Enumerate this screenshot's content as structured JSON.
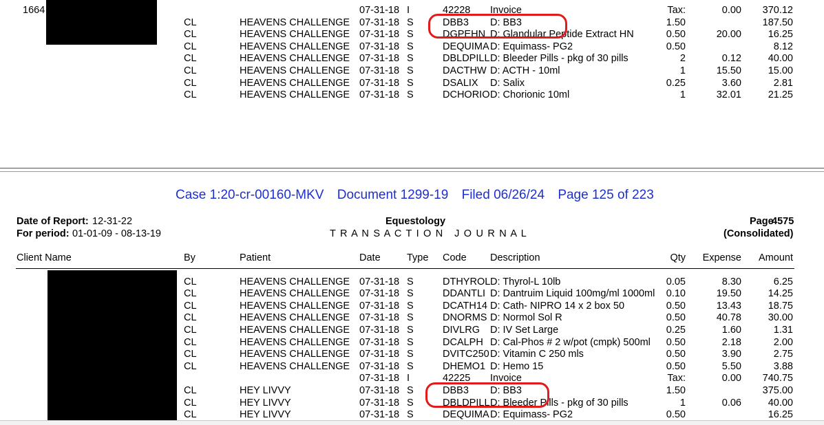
{
  "top_section": {
    "client_id": "1664",
    "rows": [
      {
        "by": "",
        "patient": "",
        "date": "07-31-18",
        "type": "I",
        "code": "42228",
        "desc": "Invoice",
        "qty": "Tax:",
        "expense": "0.00",
        "amount": "370.12"
      },
      {
        "by": "CL",
        "patient": "HEAVENS CHALLENGE",
        "date": "07-31-18",
        "type": "S",
        "code": "DBB3",
        "desc": "D: BB3",
        "qty": "1.50",
        "expense": "",
        "amount": "187.50"
      },
      {
        "by": "CL",
        "patient": "HEAVENS CHALLENGE",
        "date": "07-31-18",
        "type": "S",
        "code": "DGPEHN",
        "desc": "D: Glandular Peptide Extract HN",
        "qty": "0.50",
        "expense": "20.00",
        "amount": "16.25"
      },
      {
        "by": "CL",
        "patient": "HEAVENS CHALLENGE",
        "date": "07-31-18",
        "type": "S",
        "code": "DEQUIMA",
        "desc": "D: Equimass- PG2",
        "qty": "0.50",
        "expense": "",
        "amount": "8.12"
      },
      {
        "by": "CL",
        "patient": "HEAVENS CHALLENGE",
        "date": "07-31-18",
        "type": "S",
        "code": "DBLDPILL",
        "desc": "D: Bleeder Pills - pkg of 30 pills",
        "qty": "2",
        "expense": "0.12",
        "amount": "40.00"
      },
      {
        "by": "CL",
        "patient": "HEAVENS CHALLENGE",
        "date": "07-31-18",
        "type": "S",
        "code": "DACTHW",
        "desc": "D: ACTH -   10ml",
        "qty": "1",
        "expense": "15.50",
        "amount": "15.00"
      },
      {
        "by": "CL",
        "patient": "HEAVENS CHALLENGE",
        "date": "07-31-18",
        "type": "S",
        "code": "DSALIX",
        "desc": "D: Salix",
        "qty": "0.25",
        "expense": "3.60",
        "amount": "2.81"
      },
      {
        "by": "CL",
        "patient": "HEAVENS CHALLENGE",
        "date": "07-31-18",
        "type": "S",
        "code": "DCHORIO",
        "desc": "D: Chorionic 10ml",
        "qty": "1",
        "expense": "32.01",
        "amount": "21.25"
      }
    ]
  },
  "case_header": {
    "case": "Case 1:20-cr-00160-MKV",
    "document": "Document 1299-19",
    "filed": "Filed 06/26/24",
    "page": "Page 125 of 223"
  },
  "report_header": {
    "date_label": "Date of Report:",
    "date_value": "12-31-22",
    "period_label": "For period:",
    "period_value": "01-01-09 - 08-13-19",
    "company": "Equestology",
    "journal": "T R A N S A C T I O N   J O U R N A L",
    "page_label": "Page",
    "page_number": "4575",
    "consolidated": "(Consolidated)"
  },
  "columns": {
    "client": "Client Name",
    "by": "By",
    "patient": "Patient",
    "date": "Date",
    "type": "Type",
    "code": "Code",
    "description": "Description",
    "qty": "Qty",
    "expense": "Expense",
    "amount": "Amount"
  },
  "bottom_section": {
    "rows": [
      {
        "by": "CL",
        "patient": "HEAVENS CHALLENGE",
        "date": "07-31-18",
        "type": "S",
        "code": "DTHYROL",
        "desc": "D: Thyrol-L 10lb",
        "qty": "0.05",
        "expense": "8.30",
        "amount": "6.25"
      },
      {
        "by": "CL",
        "patient": "HEAVENS CHALLENGE",
        "date": "07-31-18",
        "type": "S",
        "code": "DDANTLI",
        "desc": "D: Dantruim Liquid  100mg/ml 1000ml",
        "qty": "0.10",
        "expense": "19.50",
        "amount": "14.25"
      },
      {
        "by": "CL",
        "patient": "HEAVENS CHALLENGE",
        "date": "07-31-18",
        "type": "S",
        "code": "DCATH14",
        "desc": "D: Cath- NIPRO 14 x 2  box 50",
        "qty": "0.50",
        "expense": "13.43",
        "amount": "18.75"
      },
      {
        "by": "CL",
        "patient": "HEAVENS CHALLENGE",
        "date": "07-31-18",
        "type": "S",
        "code": "DNORMS",
        "desc": "D: Normol Sol R",
        "qty": "0.50",
        "expense": "40.78",
        "amount": "30.00"
      },
      {
        "by": "CL",
        "patient": "HEAVENS CHALLENGE",
        "date": "07-31-18",
        "type": "S",
        "code": "DIVLRG",
        "desc": "D: IV Set Large",
        "qty": "0.25",
        "expense": "1.60",
        "amount": "1.31"
      },
      {
        "by": "CL",
        "patient": "HEAVENS CHALLENGE",
        "date": "07-31-18",
        "type": "S",
        "code": "DCALPH",
        "desc": "D: Cal-Phos # 2 w/pot (cmpk)  500ml",
        "qty": "0.50",
        "expense": "2.18",
        "amount": "2.00"
      },
      {
        "by": "CL",
        "patient": "HEAVENS CHALLENGE",
        "date": "07-31-18",
        "type": "S",
        "code": "DVITC250",
        "desc": "D: Vitamin C 250 mls",
        "qty": "0.50",
        "expense": "3.90",
        "amount": "2.75"
      },
      {
        "by": "CL",
        "patient": "HEAVENS CHALLENGE",
        "date": "07-31-18",
        "type": "S",
        "code": "DHEMO1",
        "desc": "D: Hemo 15",
        "qty": "0.50",
        "expense": "5.50",
        "amount": "3.88"
      },
      {
        "by": "",
        "patient": "",
        "date": "07-31-18",
        "type": "I",
        "code": "42225",
        "desc": "Invoice",
        "qty": "Tax:",
        "expense": "0.00",
        "amount": "740.75"
      },
      {
        "by": "CL",
        "patient": "HEY LIVVY",
        "date": "07-31-18",
        "type": "S",
        "code": "DBB3",
        "desc": "D: BB3",
        "qty": "1.50",
        "expense": "",
        "amount": "375.00"
      },
      {
        "by": "CL",
        "patient": "HEY LIVVY",
        "date": "07-31-18",
        "type": "S",
        "code": "DBLDPILL",
        "desc": "D: Bleeder Pills - pkg of 30 pills",
        "qty": "1",
        "expense": "0.06",
        "amount": "40.00"
      },
      {
        "by": "CL",
        "patient": "HEY LIVVY",
        "date": "07-31-18",
        "type": "S",
        "code": "DEQUIMA",
        "desc": "D: Equimass- PG2",
        "qty": "0.50",
        "expense": "",
        "amount": "16.25"
      }
    ]
  },
  "colors": {
    "case_blue": "#1d2fd0",
    "highlight_red": "#e11b1b"
  }
}
